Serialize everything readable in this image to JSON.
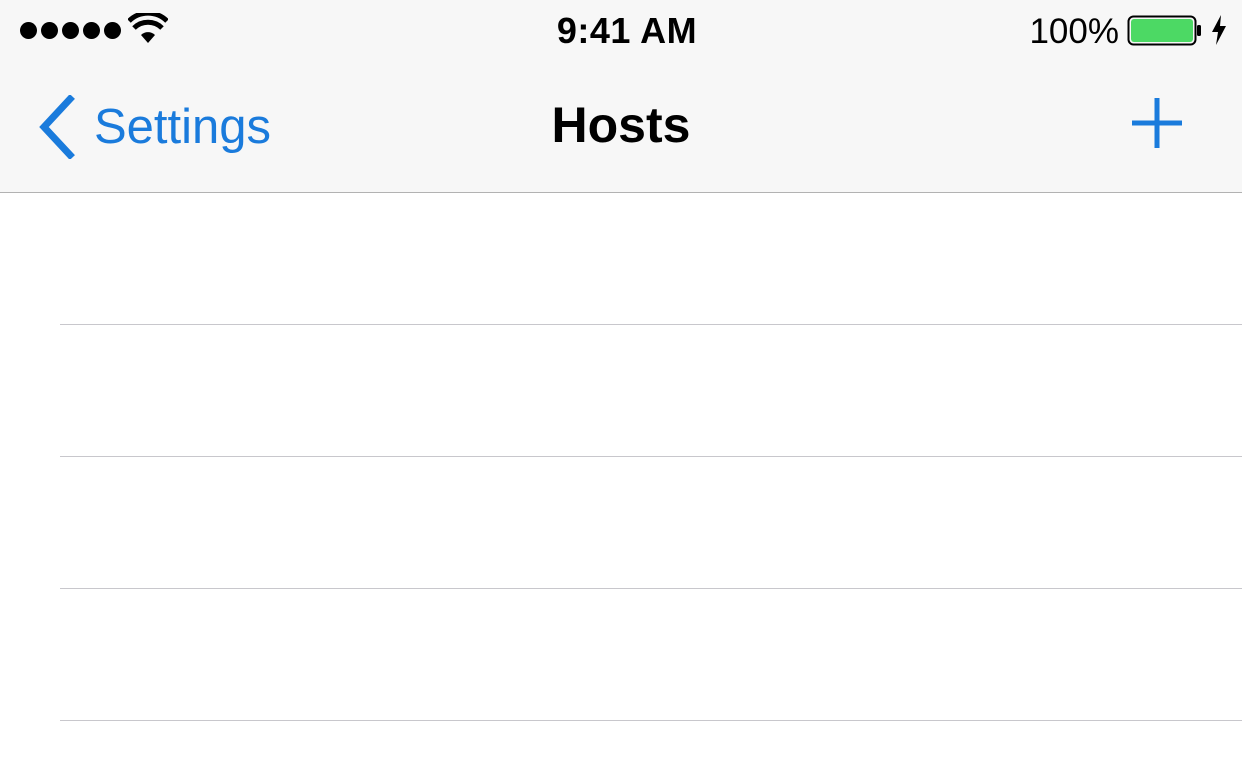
{
  "status_bar": {
    "time": "9:41 AM",
    "battery_percent": "100%",
    "battery_level": 1.0,
    "signal_bars": 5,
    "battery_color": "#4cd964"
  },
  "nav_bar": {
    "back_label": "Settings",
    "title": "Hosts",
    "back_icon": "chevron-left-icon",
    "add_icon": "plus-icon"
  },
  "colors": {
    "accent": "#1a7bdc",
    "bar_background": "#f7f7f7",
    "separator": "#c8c7cc"
  },
  "list": {
    "row_count": 4
  }
}
